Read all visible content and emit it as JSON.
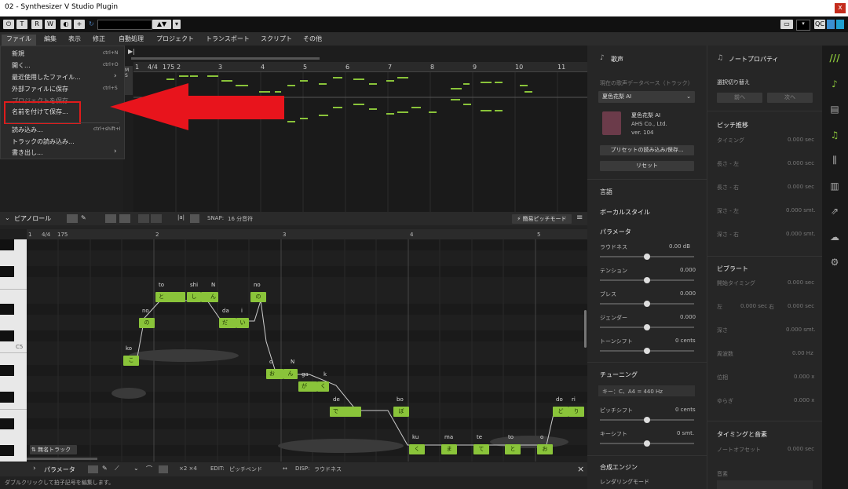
{
  "window": {
    "title": "02 - Synthesizer V Studio Plugin",
    "close": "x"
  },
  "toolbar": {
    "btn1": "⏻",
    "btn2": "T",
    "r": "R",
    "w": "W",
    "metronome": "◐",
    "plus": "+",
    "keyselect": "▲▼",
    "dropdown": "▾",
    "qc": "QC"
  },
  "menu": {
    "items": [
      "ファイル",
      "編集",
      "表示",
      "修正",
      "自動処理",
      "プロジェクト",
      "トランスポート",
      "スクリプト",
      "その他"
    ]
  },
  "file_menu": {
    "items": [
      {
        "label": "新規",
        "shortcut": "ctrl+N"
      },
      {
        "label": "開く...",
        "shortcut": "ctrl+O"
      },
      {
        "label": "最近使用したファイル...",
        "shortcut": "›"
      },
      {
        "label": "外部ファイルに保存",
        "shortcut": "ctrl+S"
      },
      {
        "label": "プロジェクトを保存",
        "shortcut": ""
      },
      {
        "label": "名前を付けて保存...",
        "shortcut": ""
      },
      {
        "label": "読み込み...",
        "shortcut": "ctrl+shift+I"
      },
      {
        "label": "トラックの読み込み...",
        "shortcut": ""
      },
      {
        "label": "書き出し...",
        "shortcut": "›"
      }
    ]
  },
  "arrangement": {
    "time_sig": "4/4",
    "tempo": "175",
    "bars": [
      "1",
      "2",
      "3",
      "4",
      "5",
      "6",
      "7",
      "8",
      "9",
      "10",
      "11"
    ]
  },
  "pianoroll": {
    "title": "ピアノロール",
    "snap_label": "SNAP:",
    "snap_value": "16 分音符",
    "pitch_mode": "簡易ピッチモード",
    "time_sig": "4/4",
    "tempo": "175",
    "bars": [
      "1",
      "2",
      "3",
      "4",
      "5"
    ],
    "c5_label": "C5",
    "track_name": "無名トラック",
    "notes": [
      {
        "phoneme": "ko",
        "lyric": "こ"
      },
      {
        "phoneme": "no",
        "lyric": "の"
      },
      {
        "phoneme": "to",
        "lyric": "と"
      },
      {
        "phoneme": "shi",
        "lyric": "し"
      },
      {
        "phoneme": "N",
        "lyric": "ん"
      },
      {
        "phoneme": "da",
        "lyric": "だ"
      },
      {
        "phoneme": "i",
        "lyric": "い"
      },
      {
        "phoneme": "no",
        "lyric": "の"
      },
      {
        "phoneme": "o",
        "lyric": "お"
      },
      {
        "phoneme": "N",
        "lyric": "ん"
      },
      {
        "phoneme": "ga",
        "lyric": "が"
      },
      {
        "phoneme": "k",
        "lyric": "く"
      },
      {
        "phoneme": "de",
        "lyric": "で"
      },
      {
        "phoneme": "bo",
        "lyric": "ぼ"
      },
      {
        "phoneme": "ku",
        "lyric": "く"
      },
      {
        "phoneme": "ma",
        "lyric": "ま"
      },
      {
        "phoneme": "te",
        "lyric": "て"
      },
      {
        "phoneme": "to",
        "lyric": "と"
      },
      {
        "phoneme": "o",
        "lyric": "お"
      },
      {
        "phoneme": "do",
        "lyric": "ど"
      },
      {
        "phoneme": "ri",
        "lyric": "り"
      }
    ]
  },
  "parameters_bar": {
    "title": "パラメータ",
    "zoom": "×2 ×4",
    "edit_label": "EDIT:",
    "edit_value": "ピッチベンド",
    "disp_label": "DISP:",
    "disp_value": "ラウドネス"
  },
  "status": {
    "hint": "ダブルクリックして拍子記号を編集します。"
  },
  "voice_panel": {
    "title": "歌声",
    "db_label": "現在の歌声データベース（トラック）",
    "db_value": "夏色花梨 AI",
    "voice_name": "夏色花梨 AI",
    "company": "AHS Co., Ltd.",
    "version": "ver. 104",
    "preset_button": "プリセットの読み込み/保存...",
    "reset_button": "リセット",
    "language": "言語",
    "vocal_style": "ボーカルスタイル",
    "params_title": "パラメータ",
    "params": [
      {
        "name": "ラウドネス",
        "value": "0.00 dB"
      },
      {
        "name": "テンション",
        "value": "0.000"
      },
      {
        "name": "ブレス",
        "value": "0.000"
      },
      {
        "name": "ジェンダー",
        "value": "0.000"
      },
      {
        "name": "トーンシフト",
        "value": "0 cents"
      }
    ],
    "tuning_title": "チューニング",
    "key_value": "キー：C、A4 = 440 Hz",
    "pitch_shift_label": "ピッチシフト",
    "pitch_shift_value": "0 cents",
    "key_shift_label": "キーシフト",
    "key_shift_value": "0 smt.",
    "engine_title": "合成エンジン",
    "render_mode": "レンダリングモード"
  },
  "note_panel": {
    "title": "ノートプロパティ",
    "select_switch": "選択切り替え",
    "prev": "前へ",
    "next": "次へ",
    "pitch_title": "ピッチ推移",
    "pitch_rows": [
      {
        "name": "タイミング",
        "value": "0.000 sec"
      },
      {
        "name": "長さ - 左",
        "value": "0.000 sec"
      },
      {
        "name": "長さ - 右",
        "value": "0.000 sec"
      },
      {
        "name": "深さ - 左",
        "value": "0.000 smt."
      },
      {
        "name": "深さ - 右",
        "value": "0.000 smt."
      }
    ],
    "vibrato_title": "ビブラート",
    "vib_start_label": "開始タイミング",
    "vib_start_value": "0.000 sec",
    "vib_left_label": "左",
    "vib_left_value": "0.000 sec",
    "vib_right_label": "右",
    "vib_right_value": "0.000 sec",
    "vib_rows": [
      {
        "name": "深さ",
        "value": "0.000 smt."
      },
      {
        "name": "周波数",
        "value": "0.00 Hz"
      },
      {
        "name": "位相",
        "value": "0.000 x"
      },
      {
        "name": "ゆらぎ",
        "value": "0.000 x"
      }
    ],
    "timing_title": "タイミングと音素",
    "note_offset_label": "ノートオフセット",
    "note_offset_value": "0.000 sec",
    "phoneme_label": "音素"
  },
  "colors": {
    "accent": "#8ac43a",
    "highlight": "#e01b1b",
    "arrow": "#e8141c"
  }
}
